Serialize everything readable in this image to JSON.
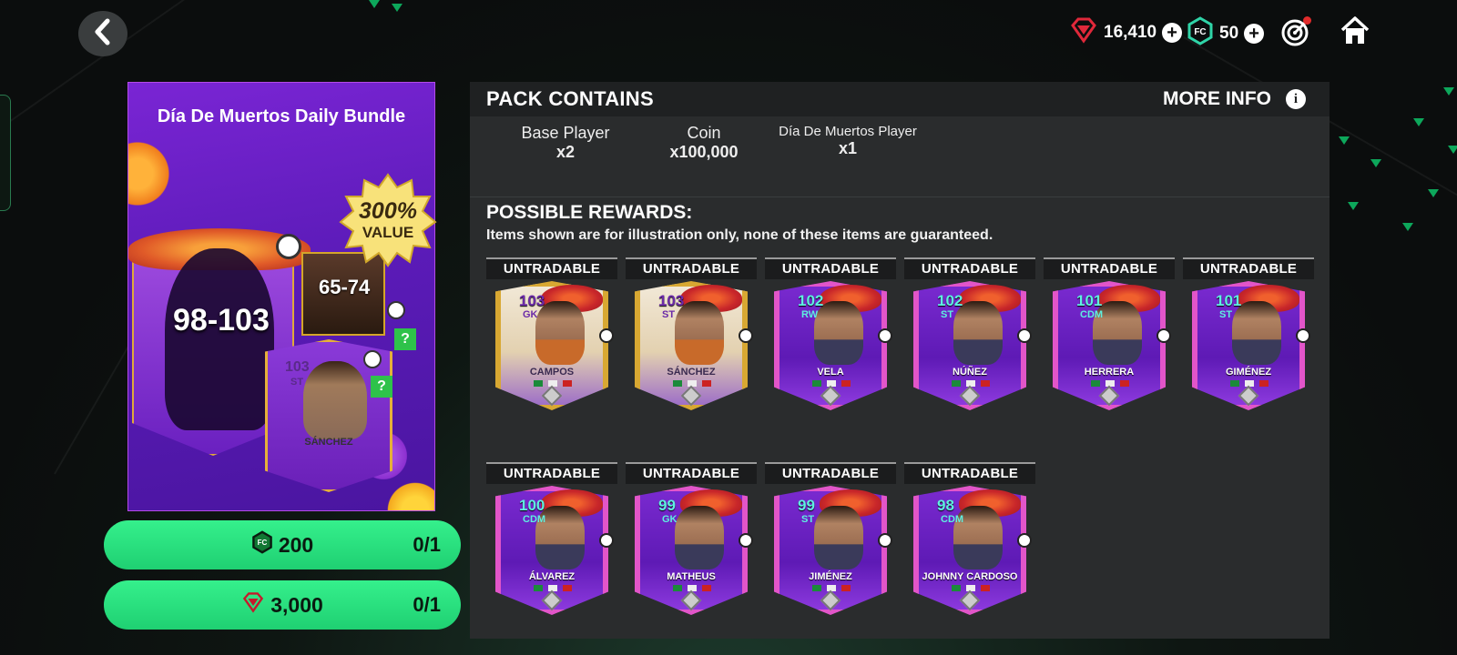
{
  "topbar": {
    "back_icon": "chevron-left-icon",
    "gems": "16,410",
    "fc_points": "50",
    "plus_label": "+",
    "objectives_icon": "target-icon",
    "home_icon": "home-icon"
  },
  "pack": {
    "title": "Día De Muertos Daily Bundle",
    "value_badge_line1": "300%",
    "value_badge_line2": "VALUE",
    "main_range": "98-103",
    "secondary_range": "65-74",
    "featured_card": {
      "rating": "103",
      "position": "ST",
      "name": "SÁNCHEZ"
    },
    "question_mark": "?"
  },
  "buy_options": [
    {
      "currency_icon": "fc-points-icon",
      "price": "200",
      "limit": "0/1"
    },
    {
      "currency_icon": "gem-icon",
      "price": "3,000",
      "limit": "0/1"
    }
  ],
  "panel": {
    "title": "PACK CONTAINS",
    "more_info": "MORE INFO",
    "info_icon_label": "i",
    "contains": [
      {
        "label": "Base Player",
        "qty": "x2"
      },
      {
        "label": "Coin",
        "qty": "x100,000"
      },
      {
        "label": "Día De Muertos Player",
        "qty": "x1"
      }
    ],
    "rewards_title": "POSSIBLE REWARDS:",
    "rewards_note": "Items shown are for illustration only, none of these items are guaranteed."
  },
  "rewards": [
    {
      "tag": "UNTRADABLE",
      "rating": "103",
      "position": "GK",
      "name": "CAMPOS",
      "style": "icon"
    },
    {
      "tag": "UNTRADABLE",
      "rating": "103",
      "position": "ST",
      "name": "SÁNCHEZ",
      "style": "icon"
    },
    {
      "tag": "UNTRADABLE",
      "rating": "102",
      "position": "RW",
      "name": "VELA",
      "style": "purple"
    },
    {
      "tag": "UNTRADABLE",
      "rating": "102",
      "position": "ST",
      "name": "NÚÑEZ",
      "style": "purple"
    },
    {
      "tag": "UNTRADABLE",
      "rating": "101",
      "position": "CDM",
      "name": "HERRERA",
      "style": "purple"
    },
    {
      "tag": "UNTRADABLE",
      "rating": "101",
      "position": "ST",
      "name": "GIMÉNEZ",
      "style": "purple"
    },
    {
      "tag": "UNTRADABLE",
      "rating": "100",
      "position": "CDM",
      "name": "ÁLVAREZ",
      "style": "purple"
    },
    {
      "tag": "UNTRADABLE",
      "rating": "99",
      "position": "GK",
      "name": "MATHEUS",
      "style": "purple"
    },
    {
      "tag": "UNTRADABLE",
      "rating": "99",
      "position": "ST",
      "name": "JIMÉNEZ",
      "style": "purple"
    },
    {
      "tag": "UNTRADABLE",
      "rating": "98",
      "position": "CDM",
      "name": "JOHNNY CARDOSO",
      "style": "purple"
    }
  ]
}
